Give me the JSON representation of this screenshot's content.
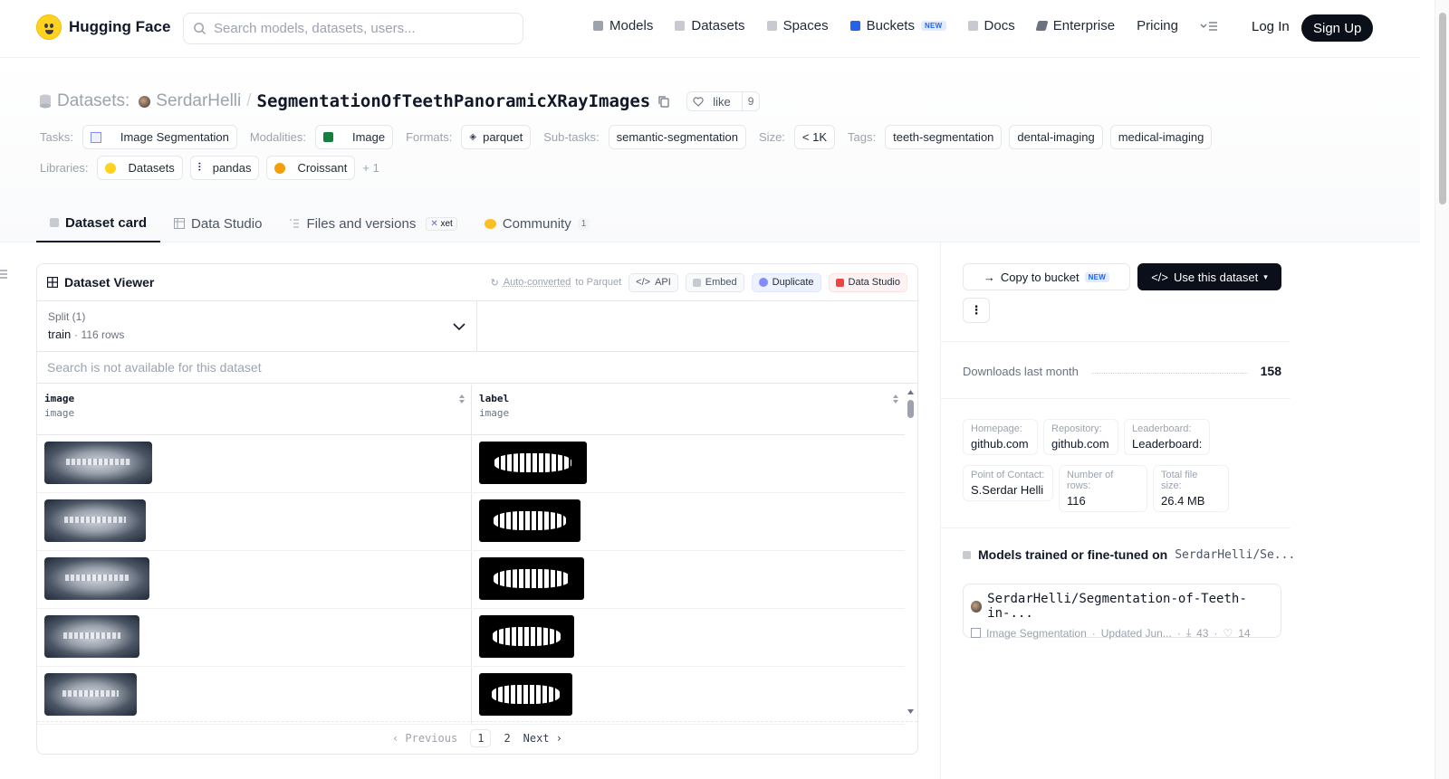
{
  "nav": {
    "brand": "Hugging Face",
    "search_placeholder": "Search models, datasets, users...",
    "links": [
      {
        "label": "Models",
        "icon": "cube-icon",
        "color": "#9ca3af"
      },
      {
        "label": "Datasets",
        "icon": "database-icon",
        "color": "#9ca3af"
      },
      {
        "label": "Spaces",
        "icon": "grid-icon",
        "color": "#9ca3af"
      },
      {
        "label": "Buckets",
        "icon": "bucket-icon",
        "color": "#2563eb",
        "badge": "NEW"
      },
      {
        "label": "Docs",
        "icon": "book-icon",
        "color": "#9ca3af"
      },
      {
        "label": "Enterprise",
        "icon": "enterprise-icon",
        "color": "#6b7280"
      },
      {
        "label": "Pricing"
      }
    ],
    "login": "Log In",
    "signup": "Sign Up"
  },
  "header": {
    "prefix": "Datasets:",
    "owner": "SerdarHelli",
    "separator": "/",
    "repo": "SegmentationOfTeethPanoramicXRayImages",
    "like_label": "like",
    "like_count": "9",
    "tasks_label": "Tasks:",
    "task": "Image Segmentation",
    "modalities_label": "Modalities:",
    "modality": "Image",
    "formats_label": "Formats:",
    "format": "parquet",
    "subtasks_label": "Sub-tasks:",
    "subtask": "semantic-segmentation",
    "size_label": "Size:",
    "size": "< 1K",
    "tags_label": "Tags:",
    "tags": [
      "teeth-segmentation",
      "dental-imaging",
      "medical-imaging"
    ],
    "libraries_label": "Libraries:",
    "libraries": [
      "Datasets",
      "pandas",
      "Croissant"
    ],
    "libraries_more": "+ 1"
  },
  "tabs": [
    {
      "label": "Dataset card"
    },
    {
      "label": "Data Studio"
    },
    {
      "label": "Files and versions",
      "badge": "xet"
    },
    {
      "label": "Community",
      "count": "1"
    }
  ],
  "viewer": {
    "title": "Dataset Viewer",
    "auto_converted": "Auto-converted",
    "to_parquet": "to Parquet",
    "api": "API",
    "embed": "Embed",
    "duplicate": "Duplicate",
    "data_studio": "Data Studio",
    "split_label": "Split (1)",
    "split_name": "train",
    "split_dot": "·",
    "split_rows": "116 rows",
    "search_placeholder": "Search is not available for this dataset",
    "columns": [
      {
        "name": "image",
        "type": "image"
      },
      {
        "name": "label",
        "type": "image"
      }
    ],
    "rows": 5,
    "pager": {
      "prev": "Previous",
      "pages": [
        "1",
        "2"
      ],
      "next": "Next"
    }
  },
  "sidebar": {
    "copy_bucket": "Copy to bucket",
    "copy_badge": "NEW",
    "use_dataset": "Use this dataset",
    "more": "⋮",
    "downloads_label": "Downloads last month",
    "downloads": "158",
    "meta": [
      {
        "k": "Homepage:",
        "v": "github.com"
      },
      {
        "k": "Repository:",
        "v": "github.com"
      },
      {
        "k": "Leaderboard:",
        "v": "Leaderboard:"
      },
      {
        "k": "Point of Contact:",
        "v": "S.Serdar Helli"
      },
      {
        "k": "Number of rows:",
        "v": "116"
      },
      {
        "k": "Total file size:",
        "v": "26.4 MB"
      }
    ],
    "models_heading": "Models trained or fine-tuned on",
    "models_target": "SerdarHelli/Se...",
    "model": {
      "name": "SerdarHelli/Segmentation-of-Teeth-in-...",
      "task": "Image Segmentation",
      "updated": "Updated Jun...",
      "downloads": "43",
      "likes": "14"
    }
  }
}
